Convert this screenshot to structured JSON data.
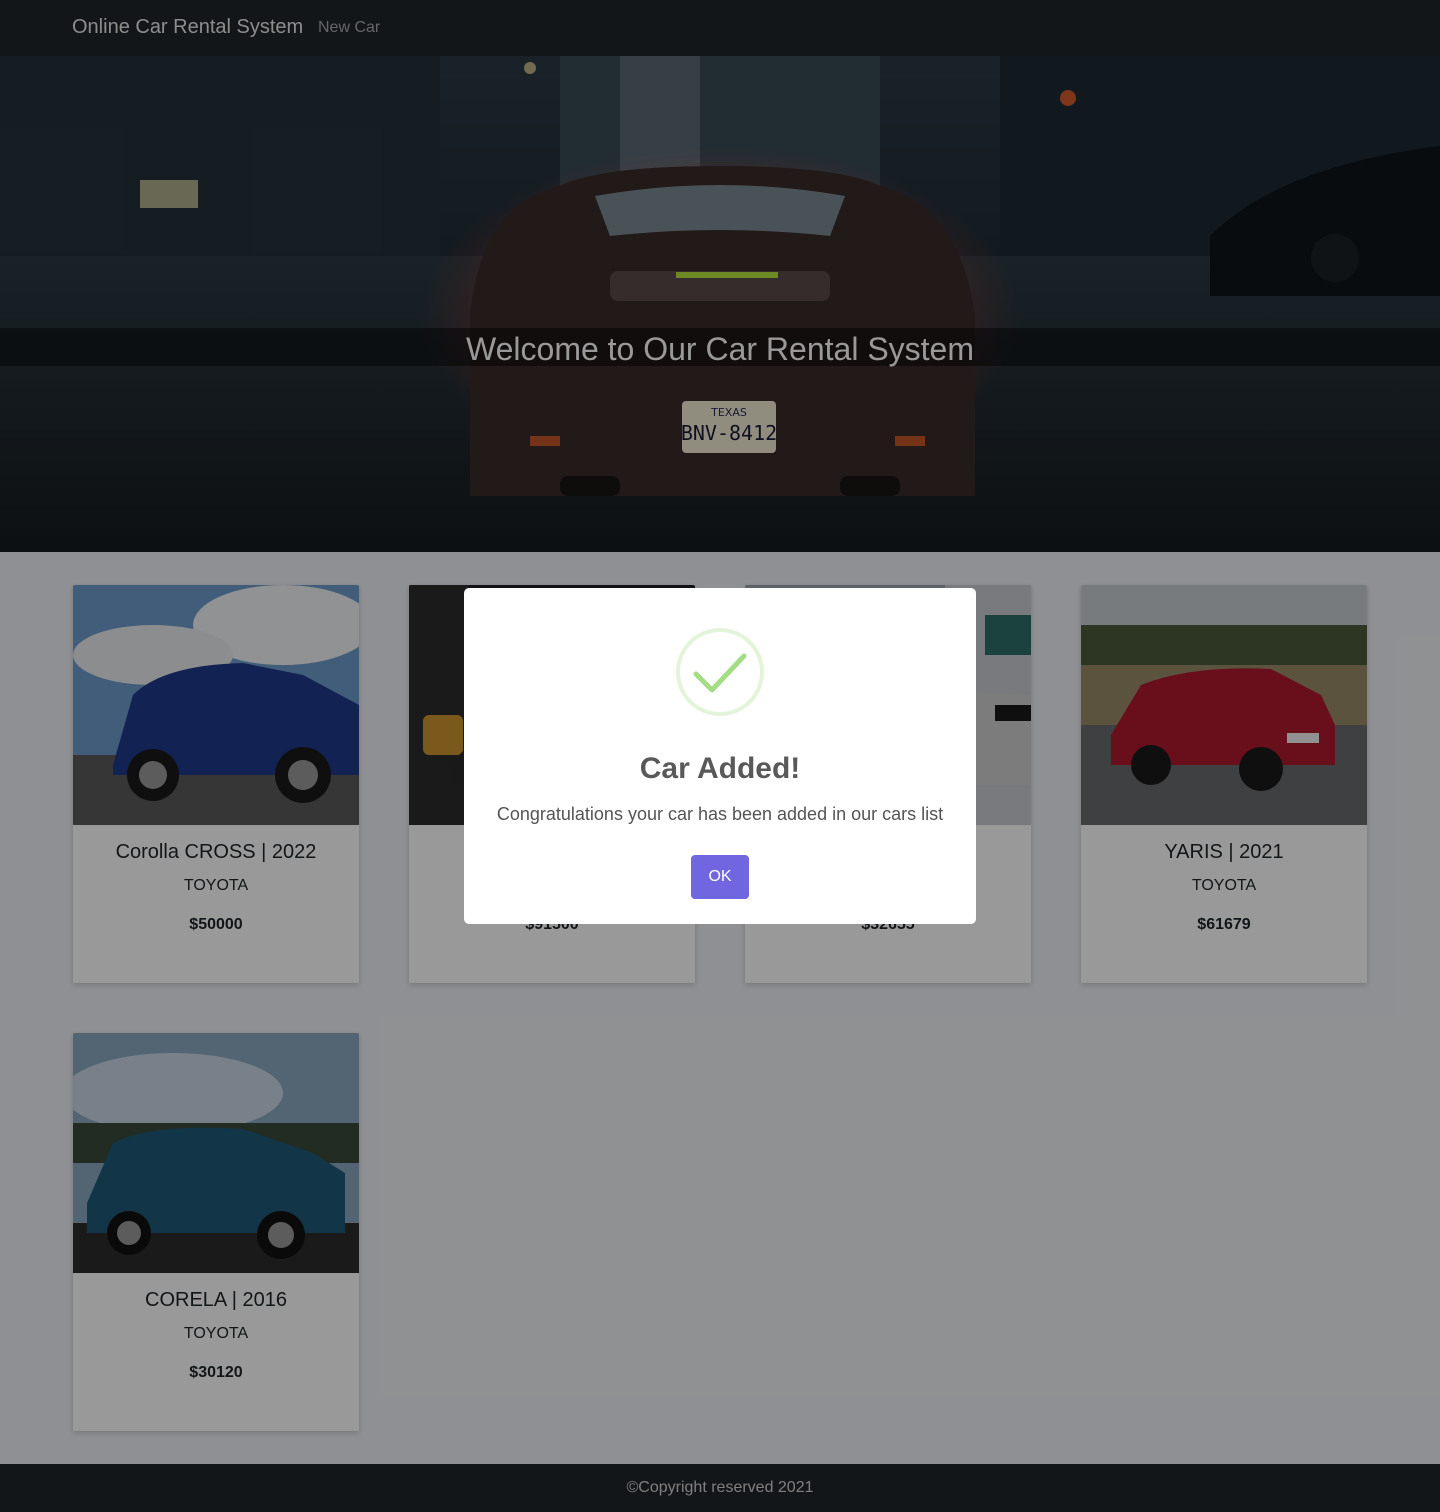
{
  "navbar": {
    "brand": "Online Car Rental System",
    "links": [
      "New Car"
    ]
  },
  "hero": {
    "title": "Welcome to Our Car Rental System",
    "plate_state": "TEXAS",
    "plate_number": "BNV-8412"
  },
  "cars": [
    {
      "title": "Corolla CROSS | 2022",
      "brand": "TOYOTA",
      "price": "$50000",
      "body_color": "#1f3a8a"
    },
    {
      "title": "",
      "brand": "",
      "price": "$91500",
      "body_color": "#2a2a2a"
    },
    {
      "title": "",
      "brand": "",
      "price": "$32655",
      "body_color": "#cfcfcf"
    },
    {
      "title": "YARIS | 2021",
      "brand": "TOYOTA",
      "price": "$61679",
      "body_color": "#b0182e"
    },
    {
      "title": "CORELA | 2016",
      "brand": "TOYOTA",
      "price": "$30120",
      "body_color": "#1e5a78"
    }
  ],
  "footer": {
    "text": "©Copyright reserved 2021"
  },
  "modal": {
    "title": "Car Added!",
    "message": "Congratulations your car has been added in our cars list",
    "ok_label": "OK",
    "icon": "check-icon",
    "accent": "#7066e0",
    "success_color": "#a5dc86"
  }
}
